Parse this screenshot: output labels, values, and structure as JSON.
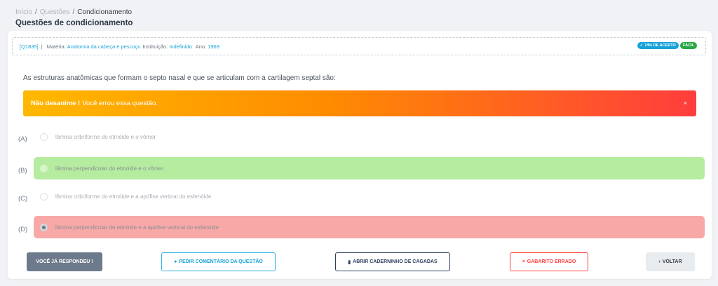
{
  "breadcrumb": {
    "home": "Início",
    "questions": "Questões",
    "current": "Condicionamento",
    "separator": "/"
  },
  "page_title": "Questões de condicionamento",
  "meta": {
    "qid": "[Q1835]",
    "pipe": "|",
    "subject_label": "Matéria:",
    "subject_value": "Anatomia da cabeça e pescoço",
    "institution_label": "Instituição:",
    "institution_value": "Indefinido",
    "year_label": "Ano:",
    "year_value": "1969",
    "accuracy_badge": "74% DE ACERTO",
    "difficulty_badge": "FÁCIL"
  },
  "question": "As estruturas anatômicas que formam o septo nasal e que se articulam com a cartilagem septal são:",
  "alert": {
    "strong": "Não desanime !",
    "text": "Você errou essa questão.",
    "close": "×"
  },
  "options": [
    {
      "letter": "(A)",
      "text": "lâmina cribriforme do etmóide e o vômer"
    },
    {
      "letter": "(B)",
      "text": "lâmina perpendicular do etmóide e o vômer"
    },
    {
      "letter": "(C)",
      "text": "lâmina cribriforme do etmóide e a apófise vertical do esfenóide"
    },
    {
      "letter": "(D)",
      "text": "lâmina perpendicular do etmóide e a apófise vertical do esfenoide"
    }
  ],
  "buttons": {
    "answered": "VOCÊ JÁ RESPONDEU !",
    "comment": "PEDIR COMENTÁRIO DA QUESTÃO",
    "notebook": "ABRIR CADERNINHO DE CAGADAS",
    "wrong_answer": "GABARITO ERRADO",
    "back": "VOLTAR"
  },
  "icons": {
    "comment": "chat-bubble-icon",
    "notebook": "book-icon",
    "wrong": "x-icon",
    "back": "chevron-left-icon",
    "accuracy": "check-icon"
  },
  "colors": {
    "accent": "#1ba3d6",
    "correct": "#b5eca0",
    "wrong": "#f9a8a8",
    "success": "#28a745",
    "danger": "#ff3d3d"
  }
}
